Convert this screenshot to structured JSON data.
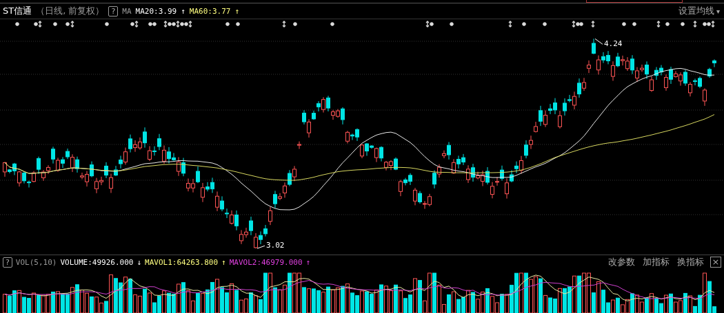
{
  "header": {
    "title": "ST信通",
    "period": "（日线, 前复权）",
    "help": "?",
    "indicator": "MA",
    "ma_values": [
      {
        "text": "MA20:3.99",
        "arrow": "↑",
        "color": "#ffffff"
      },
      {
        "text": "MA60:3.77",
        "arrow": "↑",
        "color": "#ffff80"
      }
    ],
    "settings": "设置均线",
    "settings_caret": "▾"
  },
  "price_annotations": [
    {
      "kind": "high",
      "label": "4.24"
    },
    {
      "kind": "low",
      "label": "3.02"
    }
  ],
  "volume_header": {
    "help": "?",
    "indicator": "VOL(5,10)",
    "values": [
      {
        "text": "VOLUME:49926.000",
        "arrow": "↓",
        "color": "#ffffff"
      },
      {
        "text": "MAVOL1:64263.800",
        "arrow": "↑",
        "color": "#ffff80"
      },
      {
        "text": "MAVOL2:46979.000",
        "arrow": "↑",
        "color": "#e040e0"
      }
    ],
    "actions": [
      "改参数",
      "加指标",
      "换指标"
    ],
    "close": "×"
  }
}
